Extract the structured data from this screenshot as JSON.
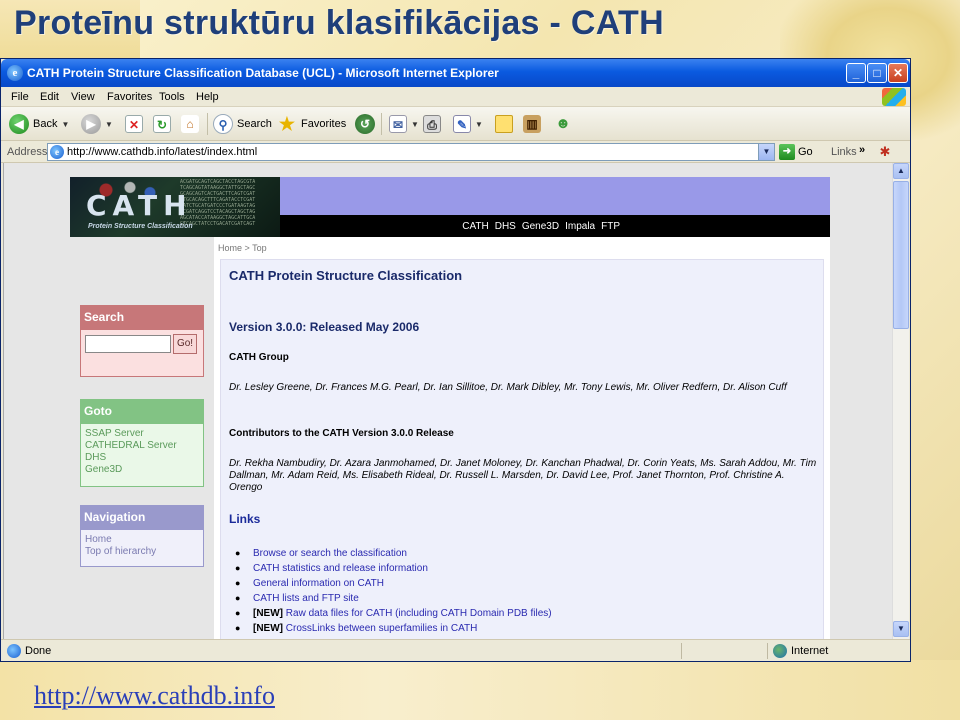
{
  "slide": {
    "title": "Proteīnu struktūru klasifikācijas - CATH",
    "link": "http://www.cathdb.info"
  },
  "window": {
    "title": "CATH Protein Structure Classification Database (UCL) - Microsoft Internet Explorer",
    "menu": [
      "File",
      "Edit",
      "View",
      "Favorites",
      "Tools",
      "Help"
    ],
    "toolbar": {
      "back": "Back",
      "search": "Search",
      "favorites": "Favorites"
    },
    "address_label": "Address",
    "address_url": "http://www.cathdb.info/latest/index.html",
    "go": "Go",
    "links": "Links",
    "status": "Done",
    "zone": "Internet"
  },
  "cath": {
    "logo": "CATH",
    "logo_sub": "Protein Structure Classification",
    "nav": [
      "CATH",
      "DHS",
      "Gene3D",
      "Impala",
      "FTP"
    ],
    "breadcrumb": "Home > Top",
    "sidebar": {
      "search_title": "Search",
      "search_button": "Go!",
      "goto_title": "Goto",
      "goto_items": [
        "SSAP Server",
        "CATHEDRAL Server",
        "DHS",
        "Gene3D"
      ],
      "nav_title": "Navigation",
      "nav_items": [
        "Home",
        "Top of hierarchy"
      ]
    },
    "heading": "CATH Protein Structure Classification",
    "version": "Version 3.0.0: Released May 2006",
    "group_title": "CATH Group",
    "group_members": "Dr. Lesley Greene, Dr. Frances M.G. Pearl, Dr. Ian Sillitoe, Dr. Mark Dibley, Mr. Tony Lewis, Mr. Oliver Redfern, Dr. Alison Cuff",
    "contrib_title": "Contributors to the CATH Version 3.0.0 Release",
    "contributors": "Dr. Rekha Nambudiry, Dr. Azara Janmohamed, Dr. Janet Moloney, Dr. Kanchan Phadwal, Dr. Corin Yeats, Ms. Sarah Addou, Mr. Tim Dallman, Mr. Adam Reid, Ms. Elisabeth Rideal, Dr. Russell L. Marsden, Dr. David Lee, Prof. Janet Thornton, Prof. Christine A. Orengo",
    "links_title": "Links",
    "links": [
      {
        "tag": "",
        "text": "Browse or search the classification"
      },
      {
        "tag": "",
        "text": "CATH statistics and release information"
      },
      {
        "tag": "",
        "text": "General information on CATH"
      },
      {
        "tag": "",
        "text": "CATH lists and FTP site"
      },
      {
        "tag": "[NEW]",
        "text": "Raw data files for CATH (including CATH Domain PDB files)"
      },
      {
        "tag": "[NEW]",
        "text": "CrossLinks between superfamilies in CATH"
      }
    ]
  }
}
